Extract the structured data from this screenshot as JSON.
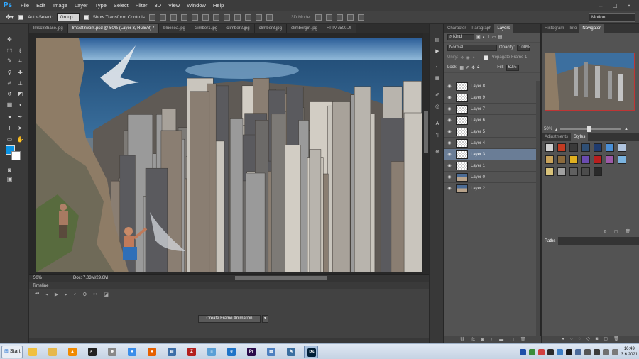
{
  "menu": {
    "logo": "Ps",
    "items": [
      "File",
      "Edit",
      "Image",
      "Layer",
      "Type",
      "Select",
      "Filter",
      "3D",
      "View",
      "Window",
      "Help"
    ],
    "window_controls": [
      "–",
      "□",
      "×"
    ]
  },
  "options_bar": {
    "auto_select_label": "Auto-Select:",
    "auto_select_value": "Group",
    "show_transform_label": "Show Transform Controls",
    "mode_3d_label": "3D Mode:",
    "workspace": "Motion"
  },
  "doc_tabs": [
    {
      "label": "lmsc83base.jpg",
      "active": false
    },
    {
      "label": "lmsc83work.psd @ 50% (Layer 3, RGB/8) *",
      "active": true
    },
    {
      "label": "bluesea.jpg",
      "active": false
    },
    {
      "label": "climber1.jpg",
      "active": false
    },
    {
      "label": "climber2.jpg",
      "active": false
    },
    {
      "label": "climber3.jpg",
      "active": false
    },
    {
      "label": "climbergirl.jpg",
      "active": false
    },
    {
      "label": "HPIM7500.JI",
      "active": false
    }
  ],
  "status": {
    "zoom": "50%",
    "doc_info": "Doc: 7.03M/29.6M"
  },
  "timeline": {
    "title": "Timeline",
    "create_button": "Create Frame Animation",
    "dropdown_icon": "▾"
  },
  "layers_panel": {
    "tabs": [
      "Character",
      "Paragraph",
      "Layers"
    ],
    "active_tab": "Layers",
    "filter_kind": "Kind",
    "blend_mode": "Normal",
    "opacity_label": "Opacity:",
    "opacity_value": "100%",
    "unify_label": "Unify:",
    "propagate_label": "Propagate Frame 1",
    "lock_label": "Lock:",
    "fill_label": "Fill:",
    "fill_value": "62%",
    "layers": [
      {
        "name": "Layer 8",
        "selected": false,
        "photo": false
      },
      {
        "name": "Layer 9",
        "selected": false,
        "photo": false
      },
      {
        "name": "Layer 7",
        "selected": false,
        "photo": false
      },
      {
        "name": "Layer 6",
        "selected": false,
        "photo": false
      },
      {
        "name": "Layer 5",
        "selected": false,
        "photo": false
      },
      {
        "name": "Layer 4",
        "selected": false,
        "photo": false
      },
      {
        "name": "Layer 3",
        "selected": true,
        "photo": false
      },
      {
        "name": "Layer 1",
        "selected": false,
        "photo": false
      },
      {
        "name": "Layer 0",
        "selected": false,
        "photo": true
      },
      {
        "name": "Layer 2",
        "selected": false,
        "photo": true
      }
    ],
    "footer_icons": [
      "link",
      "fx",
      "mask",
      "adjust",
      "folder",
      "new",
      "trash"
    ]
  },
  "right_panels": {
    "nav_tabs": [
      "Histogram",
      "Info",
      "Navigator"
    ],
    "active_nav_tab": "Navigator",
    "nav_zoom": "50%",
    "style_tabs": [
      "Adjustments",
      "Styles"
    ],
    "active_style_tab": "Styles",
    "paths_tab": "Paths",
    "swatch_colors": [
      "#d0d0d0",
      "#c23b22",
      "#3a3a3a",
      "#2f4f75",
      "#1f3b6e",
      "#4a8fd6",
      "#b0c4de",
      "#c9a35a",
      "#8b6a3c",
      "#e0b020",
      "#6a4bb0",
      "#b81e1e",
      "#9c5aa8",
      "#7bb4e0",
      "#d8c27a",
      "#a0a0a0",
      "#606060",
      "#4c4c4c",
      "#2a2a2a"
    ]
  },
  "taskbar": {
    "start_label": "Start",
    "apps": [
      {
        "name": "explorer",
        "glyph": "",
        "color": "#f0c040"
      },
      {
        "name": "folder",
        "glyph": "",
        "color": "#e6b84d"
      },
      {
        "name": "vlc",
        "glyph": "▲",
        "color": "#f08a00"
      },
      {
        "name": "terminal",
        "glyph": ">_",
        "color": "#222222"
      },
      {
        "name": "alien",
        "glyph": "☻",
        "color": "#888888"
      },
      {
        "name": "chrome",
        "glyph": "●",
        "color": "#3b8eea"
      },
      {
        "name": "firefox",
        "glyph": "●",
        "color": "#e66000"
      },
      {
        "name": "network",
        "glyph": "⊞",
        "color": "#3c6ea8"
      },
      {
        "name": "filezilla",
        "glyph": "Z",
        "color": "#b3201e"
      },
      {
        "name": "notes",
        "glyph": "≡",
        "color": "#5a9fd6"
      },
      {
        "name": "edge",
        "glyph": "e",
        "color": "#1e73c8"
      },
      {
        "name": "premiere",
        "glyph": "Pr",
        "color": "#2a0a4a"
      },
      {
        "name": "doc",
        "glyph": "▤",
        "color": "#4d7fc0"
      },
      {
        "name": "paint",
        "glyph": "✎",
        "color": "#3a6ea0"
      },
      {
        "name": "photoshop",
        "glyph": "Ps",
        "color": "#001e36"
      }
    ],
    "time": "16:49",
    "date": "3.6.2021"
  }
}
